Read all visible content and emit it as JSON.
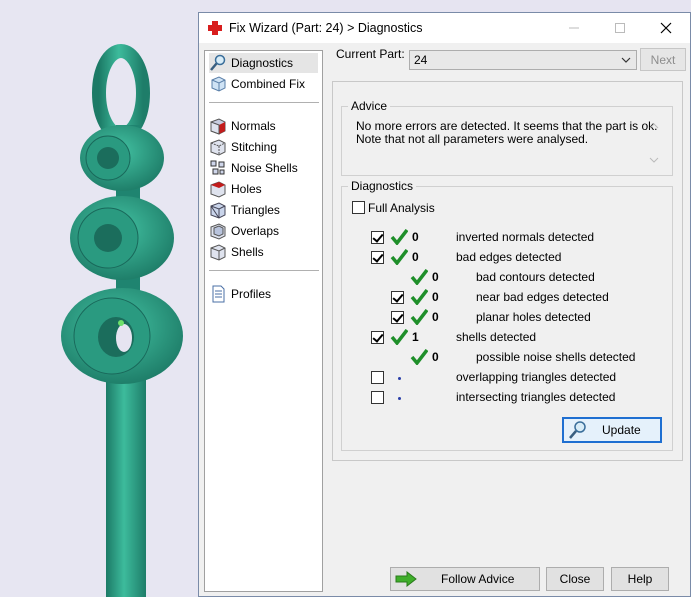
{
  "window": {
    "title": "Fix Wizard (Part: 24) > Diagnostics"
  },
  "sidebar": {
    "items": [
      {
        "label": "Diagnostics",
        "icon": "magnifier-icon",
        "selected": true
      },
      {
        "label": "Combined Fix",
        "icon": "cube-icon"
      },
      {
        "label": "Normals",
        "icon": "normals-cube-icon"
      },
      {
        "label": "Stitching",
        "icon": "stitching-icon"
      },
      {
        "label": "Noise Shells",
        "icon": "noise-shells-icon"
      },
      {
        "label": "Holes",
        "icon": "holes-icon"
      },
      {
        "label": "Triangles",
        "icon": "triangles-icon"
      },
      {
        "label": "Overlaps",
        "icon": "overlaps-icon"
      },
      {
        "label": "Shells",
        "icon": "shells-icon"
      },
      {
        "label": "Profiles",
        "icon": "profiles-document-icon"
      }
    ]
  },
  "current_part": {
    "label": "Current Part:",
    "value": "24"
  },
  "buttons": {
    "next": "Next",
    "update": "Update",
    "follow_advice": "Follow Advice",
    "close": "Close",
    "help": "Help"
  },
  "advice": {
    "title": "Advice",
    "line1": "No more errors are detected. It seems that the part is ok.",
    "line2": "Note that not all parameters were analysed."
  },
  "diagnostics": {
    "title": "Diagnostics",
    "full_analysis": "Full Analysis",
    "rows": [
      {
        "checked": true,
        "status": "ok",
        "count": "0",
        "label": "inverted normals detected",
        "indent": 0
      },
      {
        "checked": true,
        "status": "ok",
        "count": "0",
        "label": "bad edges detected",
        "indent": 0
      },
      {
        "checked": false,
        "hidden_checkbox": true,
        "status": "ok",
        "count": "0",
        "label": "bad contours detected",
        "indent": 1
      },
      {
        "checked": true,
        "status": "ok",
        "count": "0",
        "label": "near bad edges detected",
        "indent": 1
      },
      {
        "checked": true,
        "status": "ok",
        "count": "0",
        "label": "planar holes detected",
        "indent": 1
      },
      {
        "checked": true,
        "status": "ok",
        "count": "1",
        "label": "shells detected",
        "indent": 0
      },
      {
        "checked": false,
        "hidden_checkbox": true,
        "status": "ok",
        "count": "0",
        "label": "possible noise shells detected",
        "indent": 1
      },
      {
        "checked": false,
        "status": "unknown",
        "count": "",
        "label": "overlapping triangles detected",
        "indent": 0
      },
      {
        "checked": false,
        "status": "unknown",
        "count": "",
        "label": "intersecting triangles detected",
        "indent": 0
      }
    ]
  },
  "colors": {
    "model": "#2e9e86",
    "check_green": "#1f8f2a",
    "accent": "#1f6fd1"
  }
}
